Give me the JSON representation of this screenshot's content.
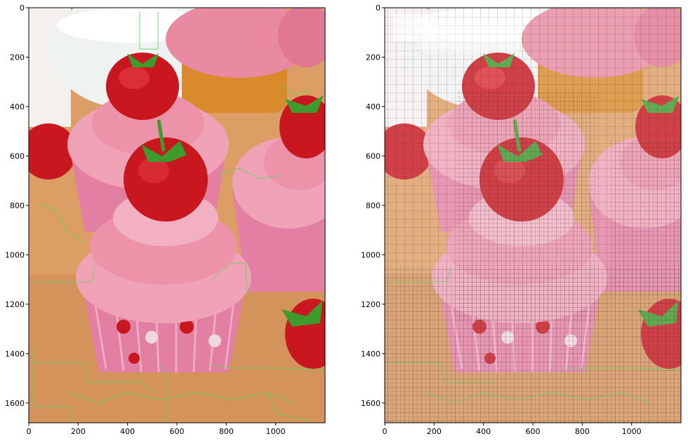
{
  "figure": {
    "panels": [
      {
        "name": "segmentation-overlay-panel",
        "image_description": "cupcakes with strawberries, green segmentation boundary overlay",
        "overlay_color": "#5fd35f",
        "x_ticks": [
          "0",
          "200",
          "400",
          "600",
          "800",
          "1000"
        ],
        "y_ticks": [
          "0",
          "200",
          "400",
          "600",
          "800",
          "1000",
          "1200",
          "1400",
          "1600"
        ]
      },
      {
        "name": "quadtree-grid-panel",
        "image_description": "cupcakes with strawberries, dark quadtree grid overlay and green boundaries",
        "overlay_color": "#3a2a2a",
        "x_ticks": [
          "0",
          "200",
          "400",
          "600",
          "800",
          "1000"
        ],
        "y_ticks": [
          "0",
          "200",
          "400",
          "600",
          "800",
          "1000",
          "1200",
          "1400",
          "1600"
        ]
      }
    ],
    "colors": {
      "wood": "#d99a63",
      "wood_light": "#e8b583",
      "frosting": "#e98aa2",
      "frosting_light": "#f2b1c2",
      "wrapper": "#e37fa3",
      "strawberry": "#c8171f",
      "strawberry_dark": "#8f0e14",
      "leaf": "#3f9a2e",
      "glass": "#eef2f1",
      "orange_cake": "#d98a2a"
    }
  }
}
